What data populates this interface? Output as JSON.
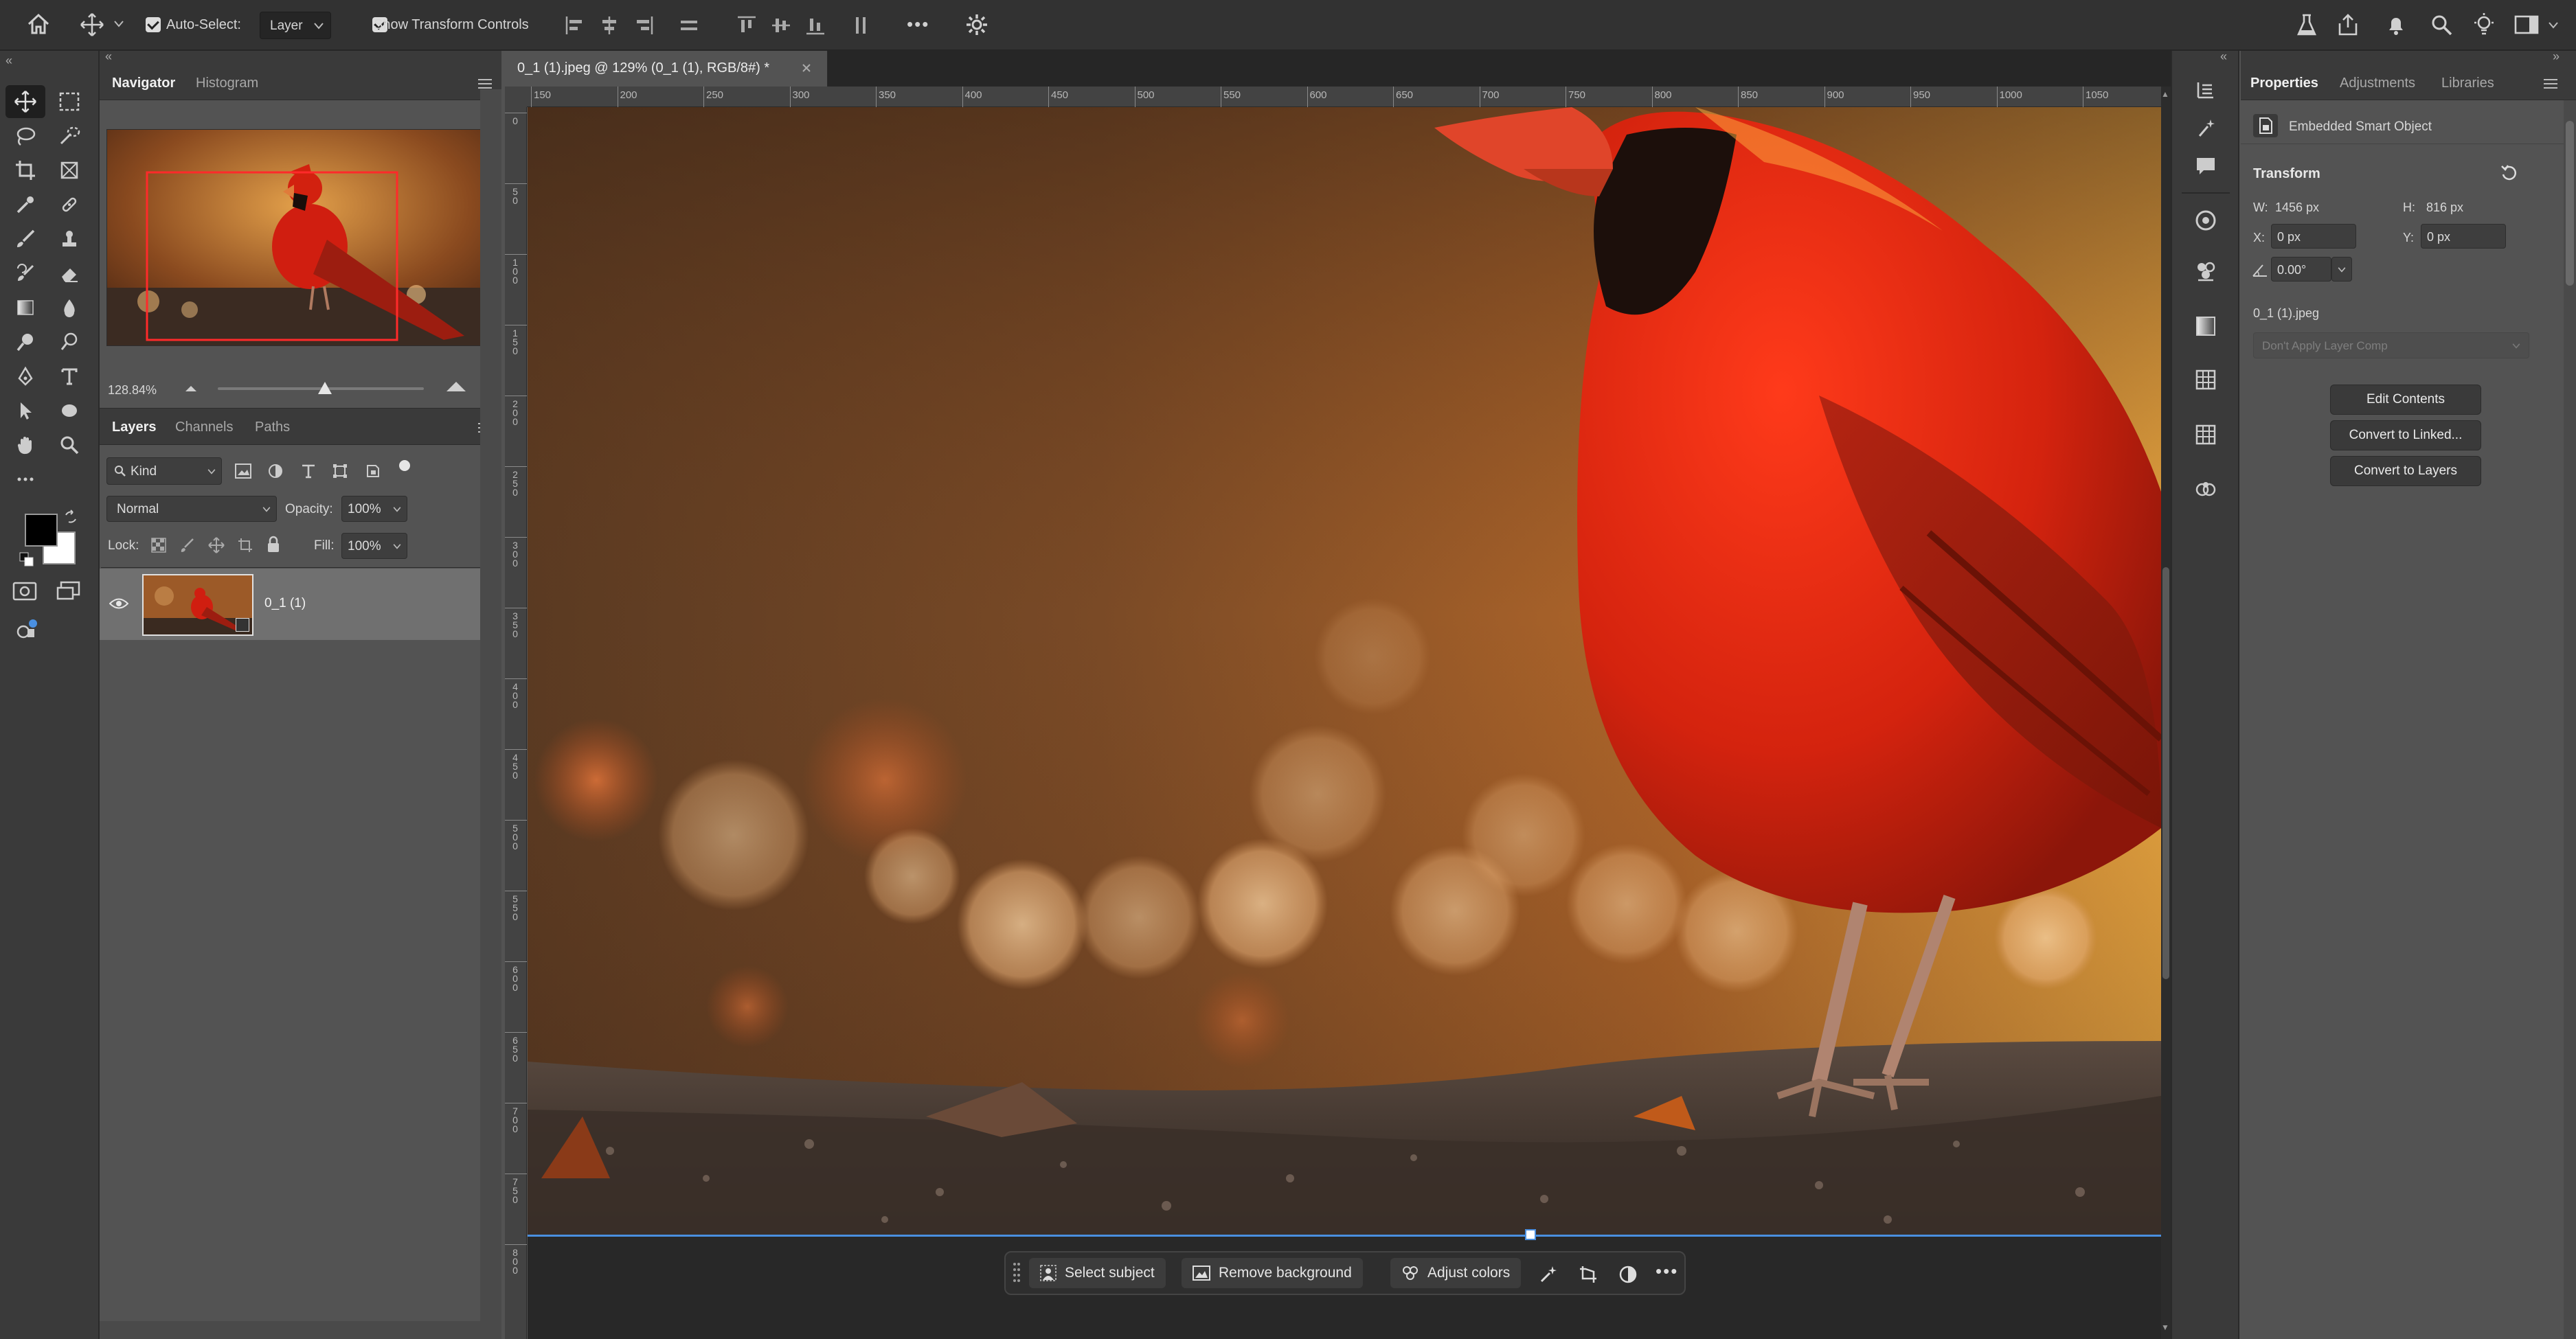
{
  "options_bar": {
    "auto_select_label": "Auto-Select:",
    "target_value": "Layer",
    "show_transform_label": "Show Transform Controls",
    "more_label": "•••"
  },
  "document": {
    "tab_title": "0_1 (1).jpeg @ 129% (0_1 (1), RGB/8#) *",
    "ruler_h": [
      "150",
      "200",
      "250",
      "300",
      "350",
      "400",
      "450",
      "500",
      "550",
      "600",
      "650",
      "700",
      "750",
      "800",
      "850",
      "900",
      "950",
      "1000",
      "1050"
    ],
    "ruler_v": [
      "0",
      "50",
      "100",
      "150",
      "200",
      "250",
      "300",
      "350",
      "400",
      "450",
      "500",
      "550",
      "600",
      "650",
      "700",
      "750",
      "800"
    ]
  },
  "navigator": {
    "tabs": [
      "Navigator",
      "Histogram"
    ],
    "zoom": "128.84%",
    "zoom_level": 0.52
  },
  "layers": {
    "tabs": [
      "Layers",
      "Channels",
      "Paths"
    ],
    "filter_kind": "Kind",
    "blend_mode": "Normal",
    "opacity_label": "Opacity:",
    "opacity_value": "100%",
    "lock_label": "Lock:",
    "fill_label": "Fill:",
    "fill_value": "100%",
    "items": [
      {
        "name": "0_1 (1)",
        "visible": true
      }
    ]
  },
  "taskbar": {
    "select_subject": "Select subject",
    "remove_background": "Remove background",
    "adjust_colors": "Adjust colors"
  },
  "properties": {
    "tabs": [
      "Properties",
      "Adjustments",
      "Libraries"
    ],
    "object_type": "Embedded Smart Object",
    "section_title": "Transform",
    "w_label": "W:",
    "w_value": "1456 px",
    "h_label": "H:",
    "h_value": "816 px",
    "x_label": "X:",
    "x_value": "0 px",
    "y_label": "Y:",
    "y_value": "0 px",
    "angle_value": "0.00°",
    "filename": "0_1 (1).jpeg",
    "layer_comp": "Don't Apply Layer Comp",
    "buttons": [
      "Edit Contents",
      "Convert to Linked...",
      "Convert to Layers"
    ]
  },
  "colors": {
    "foreground": "#000000",
    "background": "#ffffff",
    "cardinal_red": "#d4230e",
    "bokeh_gold": "#c98a3a"
  }
}
